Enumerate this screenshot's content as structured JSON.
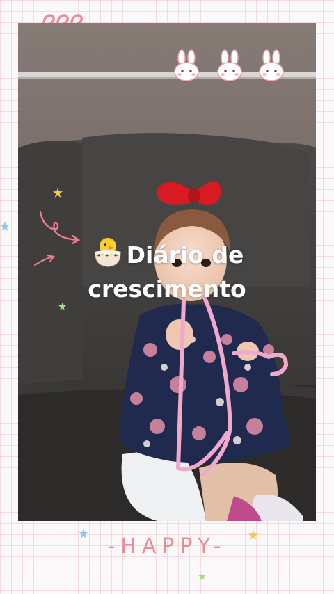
{
  "overlay": {
    "title_line1": "Diário de",
    "title_line2": "crescimento",
    "title_emoji": "hatching-chick-icon"
  },
  "footer": {
    "text": "-HAPPY-"
  },
  "colors": {
    "grid_line": "#e8c4ce",
    "accent_pink": "#e88c98",
    "star_yellow": "#f6c94a",
    "star_blue": "#8ec6ee",
    "star_green": "#a8df86"
  }
}
